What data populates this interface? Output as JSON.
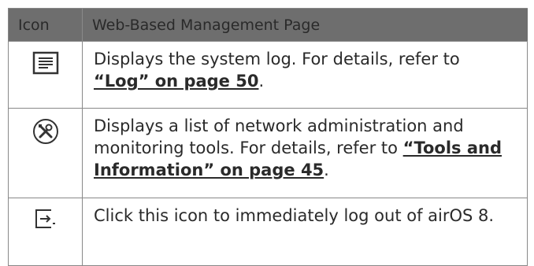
{
  "header": {
    "col_icon": "Icon",
    "col_page": "Web-Based Management Page"
  },
  "rows": [
    {
      "icon": "log-icon",
      "text": "Displays the system log. For details, refer to ",
      "link": "“Log” on page 50",
      "tail": "."
    },
    {
      "icon": "tools-icon",
      "text": "Displays a list of network administration and monitoring tools. For details, refer to ",
      "link": "“Tools and Information” on page 45",
      "tail": "."
    },
    {
      "icon": "logout-icon",
      "text": "Click this icon to immediately log out of airOS 8."
    }
  ]
}
